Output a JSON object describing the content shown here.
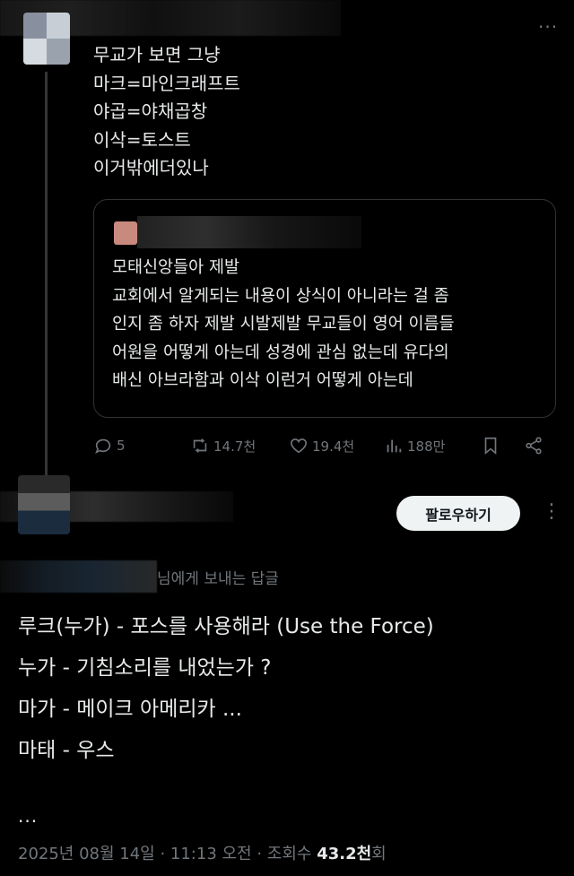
{
  "tweet1": {
    "text_lines": [
      "무교가 보면 그냥",
      "마크=마인크래프트",
      "야곱=야채곱창",
      "이삭=토스트",
      "이거밖에더있나"
    ],
    "quote": {
      "lines": [
        "모태신앙들아 제발",
        "교회에서 알게되는 내용이 상식이 아니라는 걸 좀",
        "인지 좀 하자 제발 시발제발 무교들이 영어 이름들",
        "어원을 어떻게 아는데 성경에 관심 없는데 유다의",
        "배신 아브라함과 이삭 이런거 어떻게 아는데"
      ]
    },
    "actions": {
      "replies": "5",
      "retweets": "14.7천",
      "likes": "19.4천",
      "views": "188만"
    },
    "more_icon": "···"
  },
  "tweet2": {
    "follow_label": "팔로우하기",
    "more_icon": "⋮",
    "reply_to": "님에게 보내는 답글",
    "text_lines": [
      "루크(누가) - 포스를 사용해라 (Use the Force)",
      "누가 - 기침소리를 내었는가 ?",
      "마가 - 메이크 아메리카 ...",
      "마태 - 우스"
    ],
    "ellipsis": "...",
    "meta_prefix": "2025년 08월 14일 · 11:13 오전 · 조회수 ",
    "meta_views": "43.2천",
    "meta_suffix": "회"
  },
  "icons": {
    "reply": "reply-icon",
    "retweet": "retweet-icon",
    "like": "heart-icon",
    "views": "views-icon",
    "bookmark": "bookmark-icon",
    "share": "share-icon"
  },
  "colors": {
    "background": "#000000",
    "text": "#e7e9ea",
    "muted": "#71767b",
    "border": "#2f3336",
    "button_bg": "#eff3f4"
  }
}
